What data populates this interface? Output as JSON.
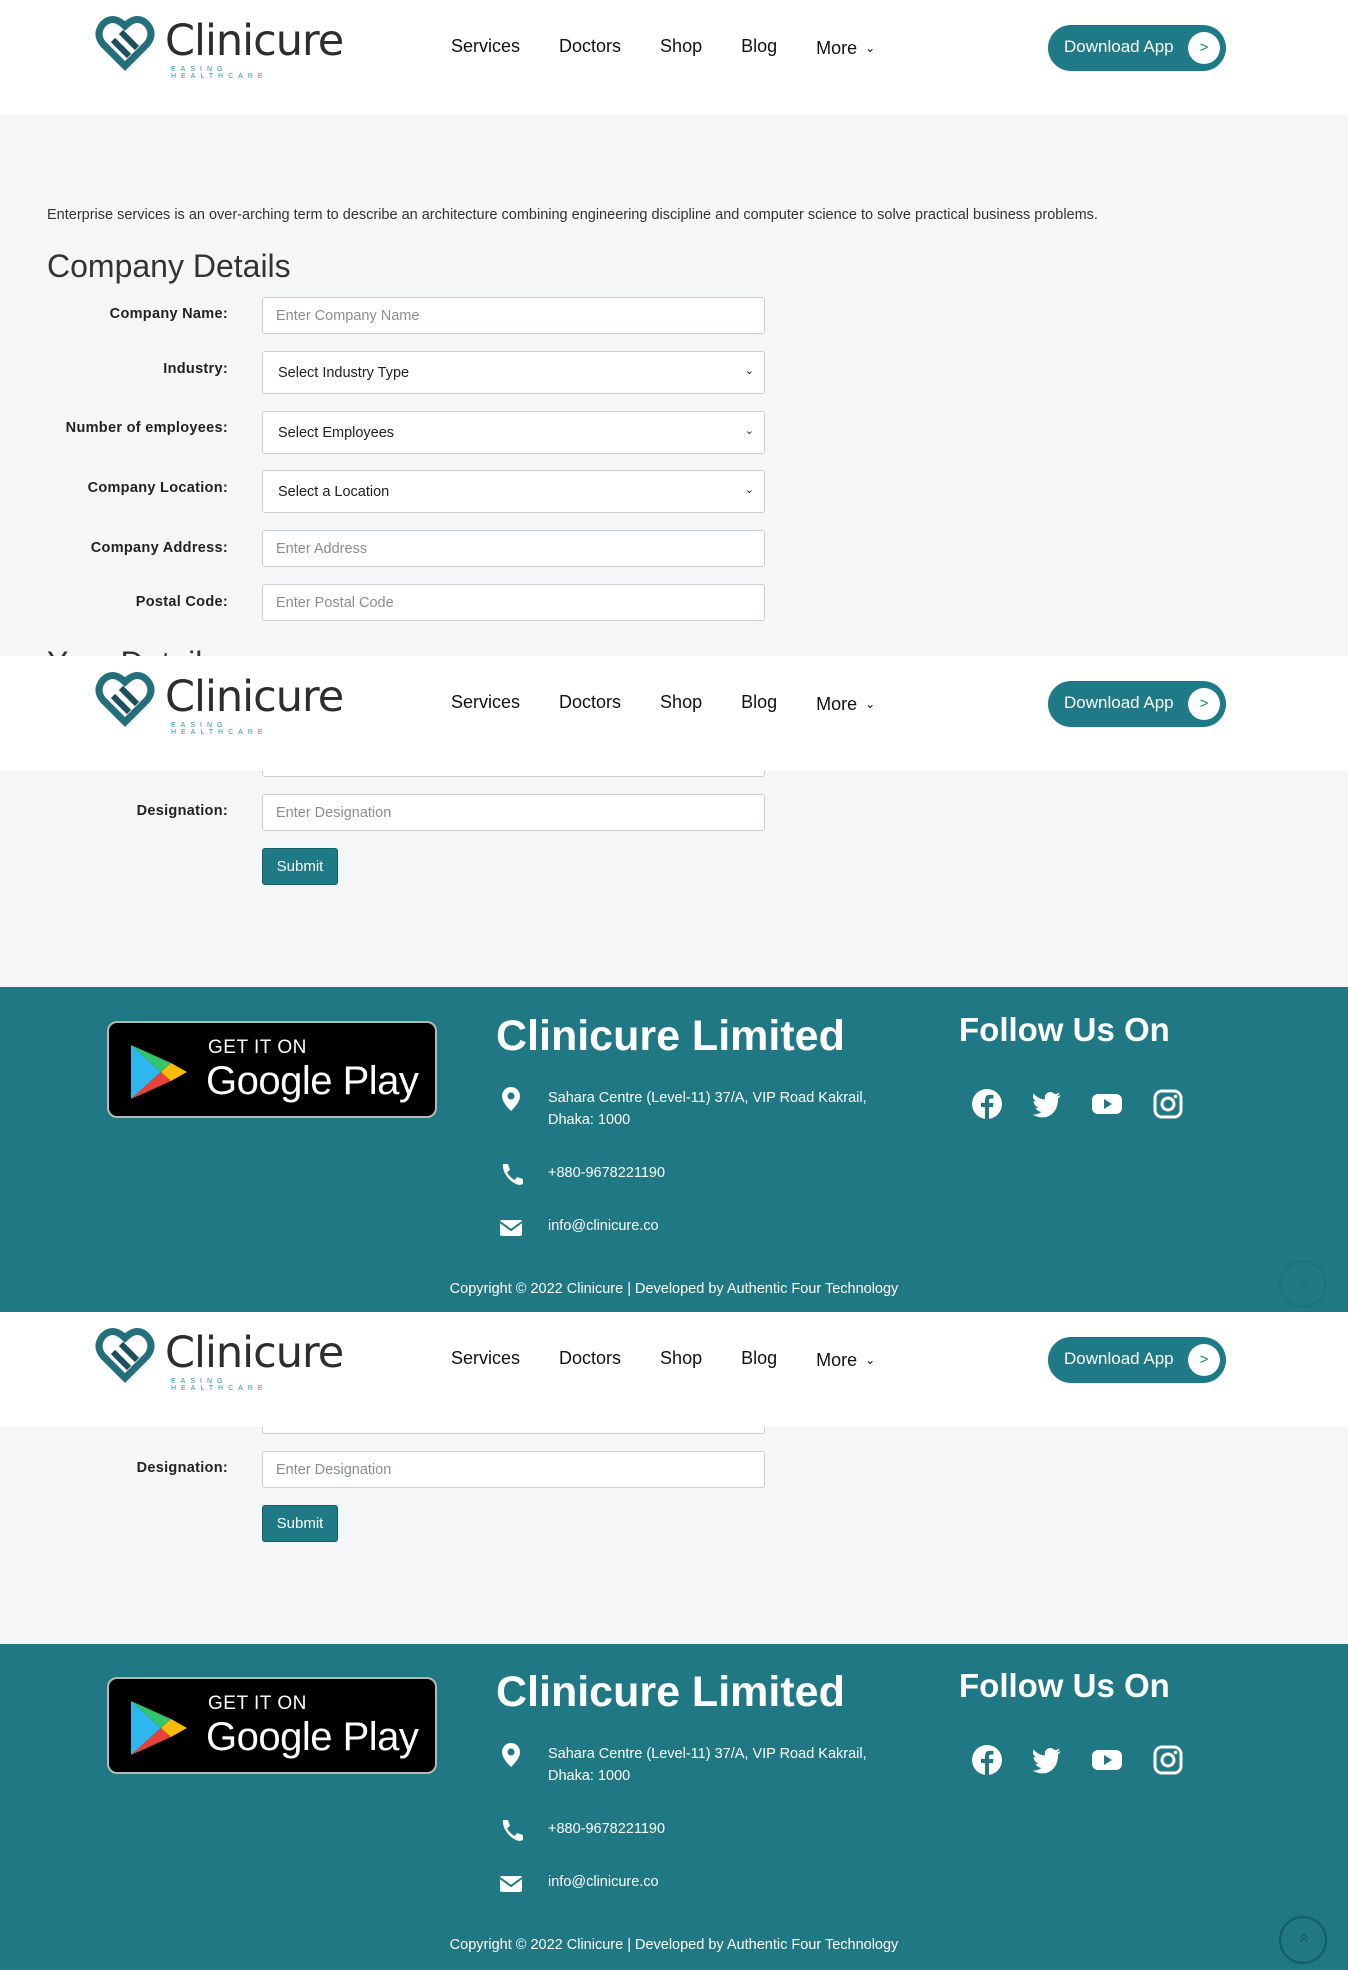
{
  "header": {
    "logo_name": "Clinicure",
    "logo_tagline": "EASING HEALTHCARE",
    "nav": [
      "Services",
      "Doctors",
      "Shop",
      "Blog",
      "More"
    ],
    "download_label": "Download App",
    "download_arrow": ">"
  },
  "intro": "Enterprise services is an over-arching term to describe an architecture combining engineering discipline and computer science to solve practical business problems.",
  "company_heading": "Company Details",
  "your_details_heading": "Your Details",
  "form": {
    "company_name": {
      "label": "Company Name:",
      "placeholder": "Enter Company Name"
    },
    "industry": {
      "label": "Industry:",
      "value": "Select Industry Type"
    },
    "employees": {
      "label": "Number of employees:",
      "value": "Select Employees"
    },
    "location": {
      "label": "Company Location:",
      "value": "Select a Location"
    },
    "address": {
      "label": "Company Address:",
      "placeholder": "Enter Address"
    },
    "postal": {
      "label": "Postal Code:",
      "placeholder": "Enter Postal Code"
    },
    "designation": {
      "label": "Designation:",
      "placeholder": "Enter Designation"
    },
    "submit": "Submit"
  },
  "footer": {
    "google_play_l1": "GET IT ON",
    "google_play_l2": "Google Play",
    "company": "Clinicure Limited",
    "address_line1": "Sahara Centre (Level-11) 37/A, VIP Road Kakrail,",
    "address_line2": "Dhaka: 1000",
    "phone": "+880-9678221190",
    "email": "info@clinicure.co",
    "follow": "Follow Us On",
    "social_icons": [
      "facebook-icon",
      "twitter-icon",
      "youtube-icon",
      "instagram-icon"
    ],
    "copyright": "Copyright © 2022 Clinicure | Developed by Authentic Four Technology",
    "to_top": "»"
  },
  "colors": {
    "brand": "#1e7a86",
    "footer_bg": "#1f7884"
  }
}
